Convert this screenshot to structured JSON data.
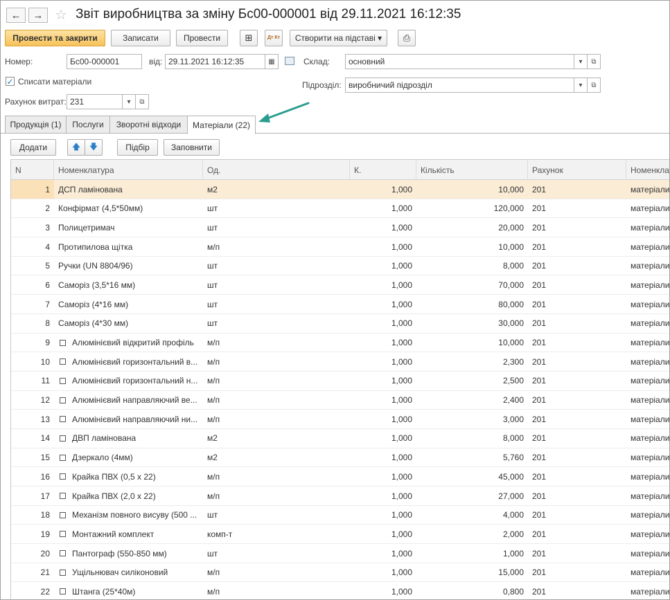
{
  "window": {
    "title": "Звіт виробництва за зміну Бс00-000001 від 29.11.2021 16:12:35",
    "back_icon": "←",
    "forward_icon": "→",
    "favorite_icon": "☆"
  },
  "toolbar": {
    "post_close": "Провести та закрити",
    "save": "Записати",
    "post": "Провести",
    "structure_icon": "⊞",
    "dtkt_icon": "Дт Кт",
    "create_based": "Створити на підставі ▾",
    "print_icon": "⎙"
  },
  "form": {
    "number_label": "Номер:",
    "number_value": "Бс00-000001",
    "date_label": "від:",
    "date_value": "29.11.2021 16:12:35",
    "calendar_icon": "▦",
    "warehouse_label": "Склад:",
    "warehouse_value": "основний",
    "writeoff_label": "Списати  матеріали",
    "writeoff_checked": "✓",
    "division_label": "Підрозділ:",
    "division_value": "виробничий підрозділ",
    "cost_account_label": "Рахунок витрат:",
    "cost_account_value": "231",
    "dropdown_icon": "▾",
    "open_icon": "⧉"
  },
  "tabs": [
    {
      "label": "Продукція (1)"
    },
    {
      "label": "Послуги"
    },
    {
      "label": "Зворотні відходи"
    },
    {
      "label": "Матеріали (22)"
    }
  ],
  "table_toolbar": {
    "add": "Додати",
    "up_icon": "🡅",
    "down_icon": "🡇",
    "select": "Підбір",
    "fill": "Заповнити"
  },
  "table": {
    "columns": [
      "N",
      "Номенклатура",
      "Од.",
      "К.",
      "Кількість",
      "Рахунок",
      "Номенклат"
    ],
    "rows": [
      {
        "n": "1",
        "name": "ДСП ламінована",
        "unit": "м2",
        "k": "1,000",
        "qty": "10,000",
        "account": "201",
        "group": "матеріали",
        "folder": false
      },
      {
        "n": "2",
        "name": "Конфірмат (4,5*50мм)",
        "unit": "шт",
        "k": "1,000",
        "qty": "120,000",
        "account": "201",
        "group": "матеріали",
        "folder": false
      },
      {
        "n": "3",
        "name": "Полицетримач",
        "unit": "шт",
        "k": "1,000",
        "qty": "20,000",
        "account": "201",
        "group": "матеріали",
        "folder": false
      },
      {
        "n": "4",
        "name": "Протипилова щітка",
        "unit": "м/п",
        "k": "1,000",
        "qty": "10,000",
        "account": "201",
        "group": "матеріали",
        "folder": false
      },
      {
        "n": "5",
        "name": "Ручки (UN 8804/96)",
        "unit": "шт",
        "k": "1,000",
        "qty": "8,000",
        "account": "201",
        "group": "матеріали",
        "folder": false
      },
      {
        "n": "6",
        "name": "Саморіз (3,5*16 мм)",
        "unit": "шт",
        "k": "1,000",
        "qty": "70,000",
        "account": "201",
        "group": "матеріали",
        "folder": false
      },
      {
        "n": "7",
        "name": "Саморіз (4*16 мм)",
        "unit": "шт",
        "k": "1,000",
        "qty": "80,000",
        "account": "201",
        "group": "матеріали",
        "folder": false
      },
      {
        "n": "8",
        "name": "Саморіз (4*30 мм)",
        "unit": "шт",
        "k": "1,000",
        "qty": "30,000",
        "account": "201",
        "group": "матеріали",
        "folder": false
      },
      {
        "n": "9",
        "name": "Алюмінієвий відкритий профіль",
        "unit": "м/п",
        "k": "1,000",
        "qty": "10,000",
        "account": "201",
        "group": "матеріали",
        "folder": true
      },
      {
        "n": "10",
        "name": "Алюмінієвий горизонтальний в...",
        "unit": "м/п",
        "k": "1,000",
        "qty": "2,300",
        "account": "201",
        "group": "матеріали",
        "folder": true
      },
      {
        "n": "11",
        "name": "Алюмінієвий горизонтальний н...",
        "unit": "м/п",
        "k": "1,000",
        "qty": "2,500",
        "account": "201",
        "group": "матеріали",
        "folder": true
      },
      {
        "n": "12",
        "name": "Алюмінієвий направляючий ве...",
        "unit": "м/п",
        "k": "1,000",
        "qty": "2,400",
        "account": "201",
        "group": "матеріали",
        "folder": true
      },
      {
        "n": "13",
        "name": "Алюмінієвий направляючий ни...",
        "unit": "м/п",
        "k": "1,000",
        "qty": "3,000",
        "account": "201",
        "group": "матеріали",
        "folder": true
      },
      {
        "n": "14",
        "name": "ДВП ламінована",
        "unit": "м2",
        "k": "1,000",
        "qty": "8,000",
        "account": "201",
        "group": "матеріали",
        "folder": true
      },
      {
        "n": "15",
        "name": "Дзеркало (4мм)",
        "unit": "м2",
        "k": "1,000",
        "qty": "5,760",
        "account": "201",
        "group": "матеріали",
        "folder": true
      },
      {
        "n": "16",
        "name": "Крайка ПВХ (0,5 х 22)",
        "unit": "м/п",
        "k": "1,000",
        "qty": "45,000",
        "account": "201",
        "group": "матеріали",
        "folder": true
      },
      {
        "n": "17",
        "name": "Крайка ПВХ (2,0 х 22)",
        "unit": "м/п",
        "k": "1,000",
        "qty": "27,000",
        "account": "201",
        "group": "матеріали",
        "folder": true
      },
      {
        "n": "18",
        "name": "Механізм повного висуву (500 ...",
        "unit": "шт",
        "k": "1,000",
        "qty": "4,000",
        "account": "201",
        "group": "матеріали",
        "folder": true
      },
      {
        "n": "19",
        "name": "Монтажний комплект",
        "unit": "комп-т",
        "k": "1,000",
        "qty": "2,000",
        "account": "201",
        "group": "матеріали",
        "folder": true
      },
      {
        "n": "20",
        "name": "Пантограф (550-850 мм)",
        "unit": "шт",
        "k": "1,000",
        "qty": "1,000",
        "account": "201",
        "group": "матеріали",
        "folder": true
      },
      {
        "n": "21",
        "name": "Ущільнювач силіконовий",
        "unit": "м/п",
        "k": "1,000",
        "qty": "15,000",
        "account": "201",
        "group": "матеріали",
        "folder": true
      },
      {
        "n": "22",
        "name": "Штанга (25*40м)",
        "unit": "м/п",
        "k": "1,000",
        "qty": "0,800",
        "account": "201",
        "group": "матеріали",
        "folder": true
      }
    ]
  },
  "colors": {
    "accent": "#f7c25a",
    "selected_row": "#fbecd6",
    "arrow": "#2a9d8f"
  }
}
